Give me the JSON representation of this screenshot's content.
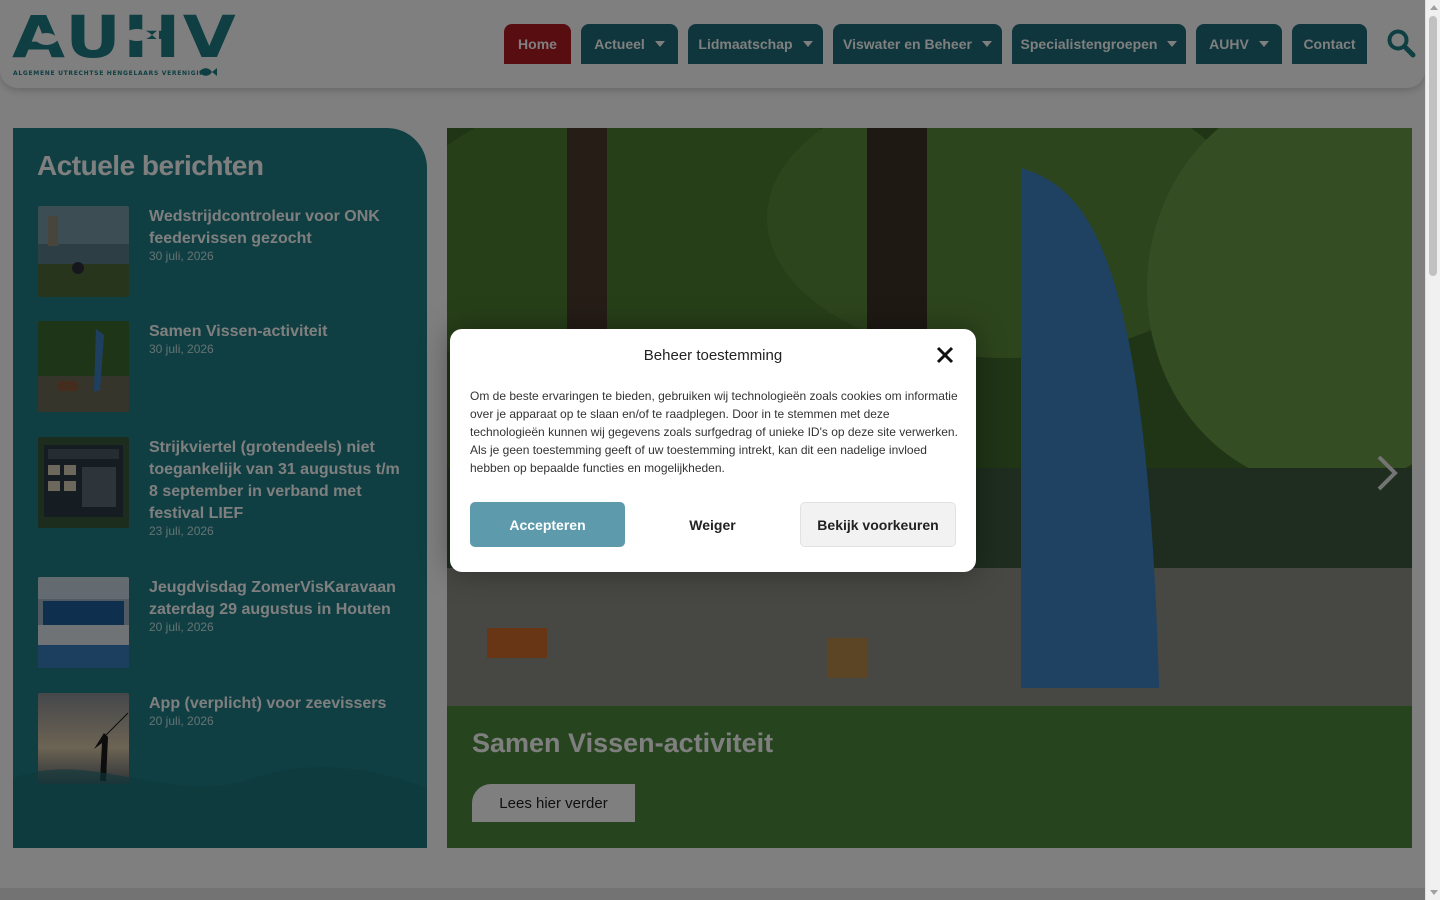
{
  "logo": {
    "letters": "AUHV",
    "tagline": "ALGEMENE UTRECHTSE HENGELAARS VERENIGING"
  },
  "nav": {
    "items": [
      {
        "label": "Home",
        "dropdown": false,
        "active": true
      },
      {
        "label": "Actueel",
        "dropdown": true,
        "active": false
      },
      {
        "label": "Lidmaatschap",
        "dropdown": true,
        "active": false
      },
      {
        "label": "Viswater en Beheer",
        "dropdown": true,
        "active": false
      },
      {
        "label": "Specialistengroepen",
        "dropdown": true,
        "active": false
      },
      {
        "label": "AUHV",
        "dropdown": true,
        "active": false
      },
      {
        "label": "Contact",
        "dropdown": false,
        "active": false
      }
    ],
    "search_icon": "search-icon"
  },
  "news": {
    "title": "Actuele berichten",
    "items": [
      {
        "headline": "Wedstrijdcontroleur voor ONK feedervissen gezocht",
        "date": "30 juli, 2026"
      },
      {
        "headline": "Samen Vissen-activiteit",
        "date": "30 juli, 2026"
      },
      {
        "headline": "Strijkviertel (grotendeels) niet toegankelijk van 31 augustus t/m 8 september in verband met festival LIEF",
        "date": "23 juli, 2026"
      },
      {
        "headline": "Jeugdvisdag ZomerVisKaravaan zaterdag 29 augustus in Houten",
        "date": "20 juli, 2026"
      },
      {
        "headline": "App (verplicht) voor zeevissers",
        "date": "20 juli, 2026"
      }
    ]
  },
  "slider": {
    "slide_title": "Samen Vissen-activiteit",
    "read_more": "Lees hier verder",
    "next_icon": "chevron-right-icon"
  },
  "consent": {
    "title": "Beheer toestemming",
    "body": "Om de beste ervaringen te bieden, gebruiken wij technologieën zoals cookies om informatie over je apparaat op te slaan en/of te raadplegen. Door in te stemmen met deze technologieën kunnen wij gegevens zoals surfgedrag of unieke ID's op deze site verwerken. Als je geen toestemming geeft of uw toestemming intrekt, kan dit een nadelige invloed hebben op bepaalde functies en mogelijkheden.",
    "accept": "Accepteren",
    "deny": "Weiger",
    "preferences": "Bekijk voorkeuren",
    "close_icon": "close-icon"
  },
  "colors": {
    "brand_teal": "#1f7f86",
    "nav_teal": "#1c6c78",
    "home_red": "#b01b22",
    "accept_blue": "#5d9aab",
    "caption_green": "#4d8a3c"
  }
}
